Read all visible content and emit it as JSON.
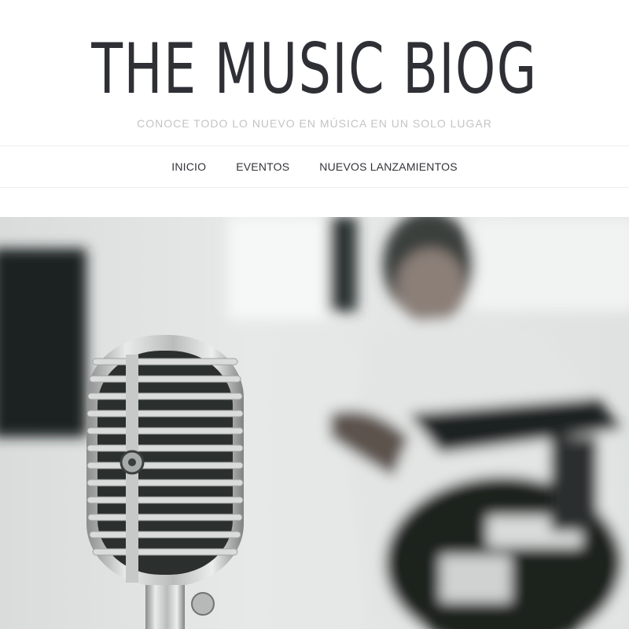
{
  "header": {
    "site_title": "THE MUSIC BIOG",
    "tagline": "CONOCE TODO LO NUEVO EN MÚSICA EN UN SOLO LUGAR"
  },
  "nav": {
    "items": [
      {
        "label": "INICIO"
      },
      {
        "label": "EVENTOS"
      },
      {
        "label": "NUEVOS LANZAMIENTOS"
      }
    ]
  },
  "colors": {
    "title": "#2f3036",
    "tagline": "#c4c4c4",
    "nav_text": "#33343a",
    "divider": "#ececec"
  }
}
